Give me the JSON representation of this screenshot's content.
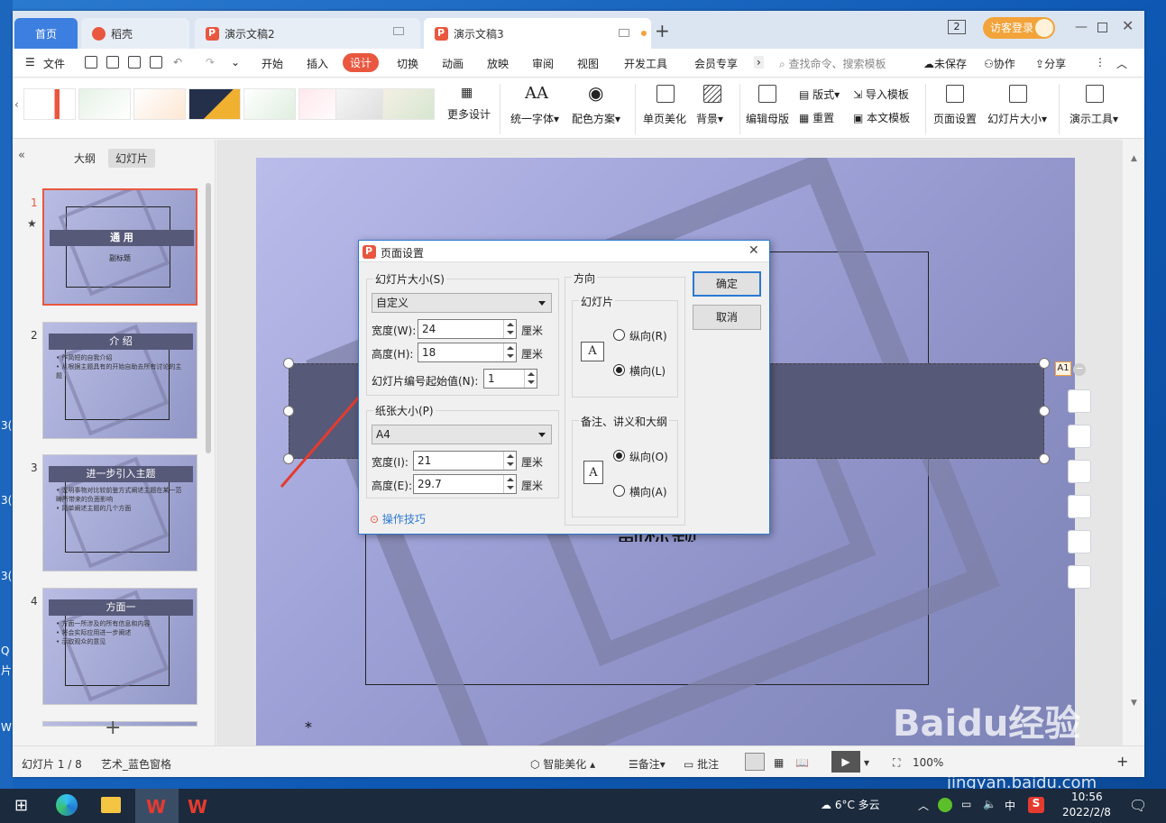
{
  "desktop": {
    "edge_texts": [
      "3(",
      "3(",
      "3(",
      "Q",
      "片",
      "W"
    ]
  },
  "window": {
    "tabs": {
      "home": "首页",
      "tab1": "稻壳",
      "tab2": "演示文稿2",
      "tab3": "演示文稿3"
    },
    "login_label": "访客登录",
    "badge": "2"
  },
  "menu": {
    "file": "文件",
    "items": [
      "开始",
      "插入",
      "设计",
      "切换",
      "动画",
      "放映",
      "审阅",
      "视图",
      "开发工具",
      "会员专享"
    ],
    "active_item": "设计",
    "search_placeholder": "查找命令、搜索模板",
    "unsaved": "未保存",
    "collab": "协作",
    "share": "分享"
  },
  "ribbon": {
    "more_design": "更多设计",
    "unify_font": "统一字体",
    "color_scheme": "配色方案",
    "single_beautify": "单页美化",
    "background": "背景",
    "edit_master": "编辑母版",
    "layout": "版式",
    "reset": "重置",
    "import_template": "导入模板",
    "this_template": "本文模板",
    "page_setup": "页面设置",
    "slide_size": "幻灯片大小",
    "present_tools": "演示工具",
    "thumb_texts": [
      "",
      "",
      "",
      "",
      "",
      "",
      "",
      ""
    ]
  },
  "left_panel": {
    "tab_outline": "大纲",
    "tab_slides": "幻灯片",
    "slides": [
      {
        "num": "1",
        "title": "通 用",
        "sub": "副标题"
      },
      {
        "num": "2",
        "title": "介 绍",
        "lines": [
          "• 作简短的自我介绍",
          "• 从根据主题具有的开始自助去所有讨论的主题"
        ]
      },
      {
        "num": "3",
        "title": "进一步引入主题",
        "lines": [
          "• 说明事物对比较前鉴方式阐述主题在某一范畴所带来的负面影响",
          "• 简单阐述主题的几个方面"
        ]
      },
      {
        "num": "4",
        "title": "方面一",
        "lines": [
          "• 方面一所涉及的所有信息和内容",
          "• 将会实际应用进一步阐述",
          "• 示取观众的意见"
        ]
      }
    ]
  },
  "slide": {
    "subtitle_partial": "副标题",
    "handle_label": "A1",
    "asterisk": "*"
  },
  "dialog": {
    "title": "页面设置",
    "slide_size_group": "幻灯片大小(S)",
    "size_preset": "自定义",
    "width_label": "宽度(W):",
    "width_value": "24",
    "height_label": "高度(H):",
    "height_value": "18",
    "unit": "厘米",
    "start_num_label": "幻灯片编号起始值(N):",
    "start_num_value": "1",
    "paper_group": "纸张大小(P)",
    "paper_preset": "A4",
    "paper_width_label": "宽度(I):",
    "paper_width_value": "21",
    "paper_height_label": "高度(E):",
    "paper_height_value": "29.7",
    "tips": "操作技巧",
    "orientation_group": "方向",
    "slide_sub": "幻灯片",
    "portrait": "纵向(R)",
    "landscape": "横向(L)",
    "notes_group": "备注、讲义和大纲",
    "notes_portrait": "纵向(O)",
    "notes_landscape": "横向(A)",
    "ok": "确定",
    "cancel": "取消"
  },
  "statusbar": {
    "slide_count": "幻灯片 1 / 8",
    "theme": "艺术_蓝色窗格",
    "smart_beautify": "智能美化",
    "notes": "备注",
    "comments": "批注",
    "zoom": "100%"
  },
  "taskbar": {
    "weather": "6°C 多云",
    "ime": "中",
    "time": "10:56",
    "date": "2022/2/8"
  },
  "watermark": {
    "text": "Baidu经验",
    "url": "jingyan.baidu.com"
  },
  "colors": {
    "accent": "#e9573f",
    "tab_blue": "#3d7fe0",
    "dialog_border": "#2b79d3",
    "band": "#575979",
    "arrow": "#e53b2e"
  }
}
